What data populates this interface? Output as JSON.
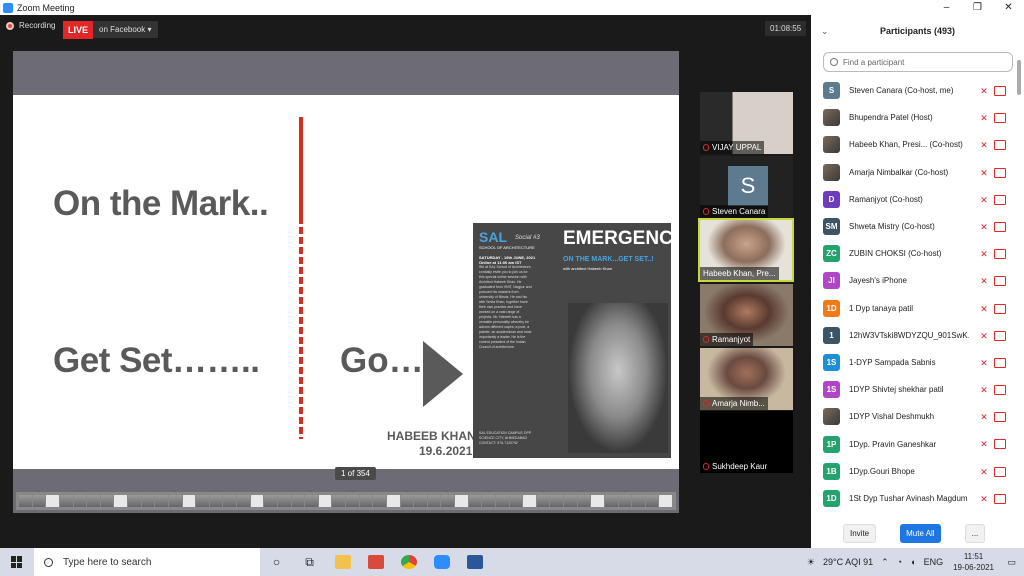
{
  "window": {
    "title": "Zoom Meeting",
    "controls": [
      "–",
      "❐",
      "✕"
    ]
  },
  "toolbar": {
    "recording_label": "Recording",
    "live_label": "LIVE",
    "live_on": "on Facebook",
    "dropdown": "▾",
    "timer": "01:08:55"
  },
  "slide": {
    "line1": "On the Mark..",
    "line2": "Get Set……..",
    "line3": "Go…",
    "name": "HABEEB KHAN",
    "date": "19.6.2021",
    "pager": "1 of 354",
    "poster": {
      "logo": "SAL",
      "social": "Social #3",
      "school": "SCHOOL OF ARCHITECTURE",
      "date_line": "SATURDAY - 19th JUNE, 2021",
      "time_line": "Online at 11:00 am IST",
      "body": "We at SAL School of Architecture, cordially invite you to join us for this special online session with Architect Habeeb Khan. He graduated from VNIT, Nagpur and pursued his masters from university of Illinois. He and his wife Smita Khan, together have their own practice and have worked on a vast range of projects. Mr. Habeeb has a versatile personality whereby he adorns different capes; a poet, a painter, an academician and most importantly a leader. He is the current president of the Indian Council of architecture.",
      "title": "EMERGENCE",
      "subtitle": "ON THE MARK...GET SET..!",
      "with": "with architect Habeeb Khan",
      "footer": "SAL EDUCATION CAMPUS OPP. SCIENCE CITY, AHMEDABAD CONTACT: 976-7120792"
    }
  },
  "tiles": [
    {
      "name": "VIJAY UPPAL"
    },
    {
      "name": "Steven Canara",
      "initial": "S"
    },
    {
      "name": "Habeeb Khan, Pre..."
    },
    {
      "name": "Ramanjyot"
    },
    {
      "name": "Amarja Nimb..."
    },
    {
      "name": "Sukhdeep Kaur"
    }
  ],
  "participants": {
    "title": "Participants (493)",
    "search_placeholder": "Find a participant",
    "list": [
      {
        "initial": "S",
        "name": "Steven Canara (Co-host, me)",
        "color": "#5d7a8e"
      },
      {
        "initial": "",
        "name": "Bhupendra Patel (Host)",
        "color": "#6a6a6a"
      },
      {
        "initial": "",
        "name": "Habeeb Khan, Presi... (Co-host)",
        "color": "#6a6a6a"
      },
      {
        "initial": "",
        "name": "Amarja Nimbalkar (Co-host)",
        "color": "#6a6a6a"
      },
      {
        "initial": "D",
        "name": "Ramanjyot (Co-host)",
        "color": "#6d3bbd"
      },
      {
        "initial": "SM",
        "name": "Shweta Mistry (Co-host)",
        "color": "#3d5466"
      },
      {
        "initial": "ZC",
        "name": "ZUBIN CHOKSI (Co-host)",
        "color": "#24a36f"
      },
      {
        "initial": "JI",
        "name": "Jayesh's iPhone",
        "color": "#b046c6"
      },
      {
        "initial": "1D",
        "name": "1 Dyp tanaya patil",
        "color": "#ef7a1a"
      },
      {
        "initial": "1",
        "name": "12hW3VTski8WDYZQU_901SwK...",
        "color": "#3d5466"
      },
      {
        "initial": "1S",
        "name": "1-DYP Sampada Sabnis",
        "color": "#1e8ed6"
      },
      {
        "initial": "1S",
        "name": "1DYP Shivtej shekhar patil",
        "color": "#b046c6"
      },
      {
        "initial": "",
        "name": "1DYP Vishal Deshmukh",
        "color": "#6a6a6a"
      },
      {
        "initial": "1P",
        "name": "1Dyp. Pravin Ganeshkar",
        "color": "#24a36f"
      },
      {
        "initial": "1B",
        "name": "1Dyp.Gouri Bhope",
        "color": "#24a36f"
      },
      {
        "initial": "1D",
        "name": "1St Dyp Tushar Avinash Magdum",
        "color": "#24a36f"
      }
    ],
    "invite": "Invite",
    "mute_all": "Mute All",
    "more": "..."
  },
  "taskbar": {
    "search_placeholder": "Type here to search",
    "weather": "29°C  AQI 91",
    "lang": "ENG",
    "time": "11:51",
    "date": "19-06-2021"
  }
}
